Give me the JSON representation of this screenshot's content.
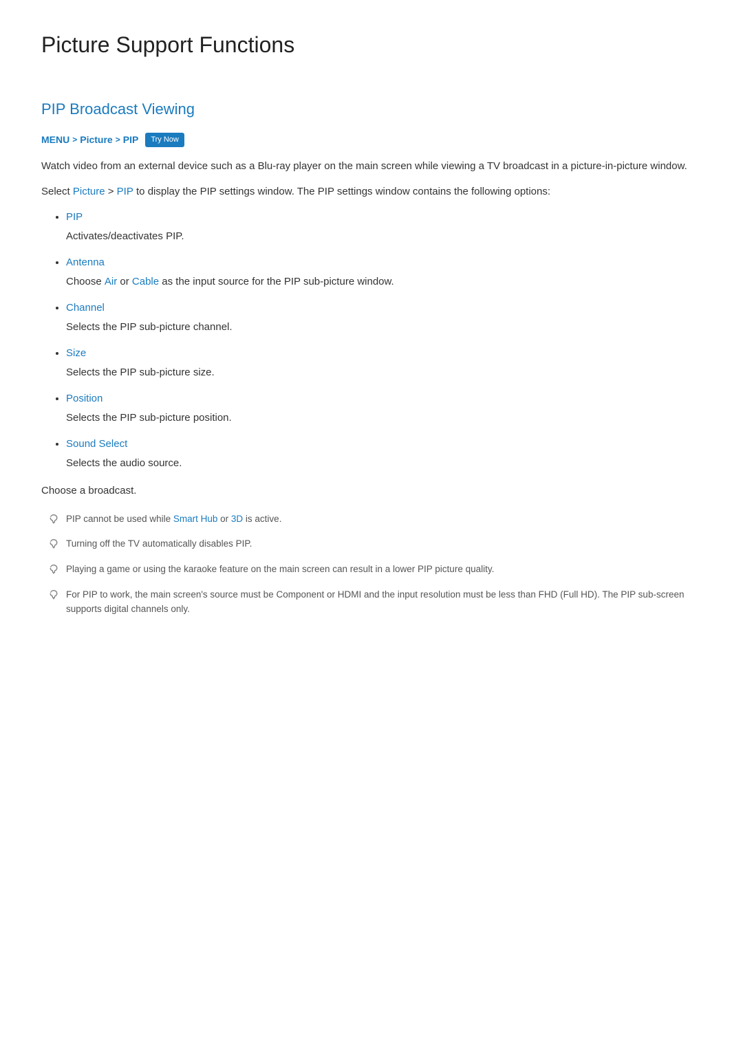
{
  "page": {
    "title": "Picture Support Functions",
    "section_title": "PIP Broadcast Viewing",
    "breadcrumb": {
      "menu": "MENU",
      "separator1": ">",
      "picture": "Picture",
      "separator2": ">",
      "pip": "PIP",
      "try_now": "Try Now"
    },
    "description1": "Watch video from an external device such as a Blu-ray player on the main screen while viewing a TV broadcast in a picture-in-picture window.",
    "description2_prefix": "Select ",
    "description2_picture": "Picture",
    "description2_mid": " > ",
    "description2_pip": "PIP",
    "description2_suffix": " to display the PIP settings window. The PIP settings window contains the following options:",
    "bullet_items": [
      {
        "title": "PIP",
        "description": "Activates/deactivates PIP."
      },
      {
        "title": "Antenna",
        "description_prefix": "Choose ",
        "air": "Air",
        "description_mid": " or ",
        "cable": "Cable",
        "description_suffix": " as the input source for the PIP sub-picture window.",
        "type": "mixed"
      },
      {
        "title": "Channel",
        "description": "Selects the PIP sub-picture channel."
      },
      {
        "title": "Size",
        "description": "Selects the PIP sub-picture size."
      },
      {
        "title": "Position",
        "description": "Selects the PIP sub-picture position."
      },
      {
        "title": "Sound Select",
        "description": "Selects the audio source."
      }
    ],
    "choose_broadcast": "Choose a broadcast.",
    "notes": [
      {
        "text_prefix": "PIP cannot be used while ",
        "smart_hub": "Smart Hub",
        "text_mid": " or ",
        "three_d": "3D",
        "text_suffix": " is active.",
        "type": "mixed"
      },
      {
        "text": "Turning off the TV automatically disables PIP.",
        "type": "plain"
      },
      {
        "text": "Playing a game or using the karaoke feature on the main screen can result in a lower PIP picture quality.",
        "type": "plain"
      },
      {
        "text": "For PIP to work, the main screen's source must be Component or HDMI and the input resolution must be less than FHD (Full HD). The PIP sub-screen supports digital channels only.",
        "type": "plain"
      }
    ]
  }
}
